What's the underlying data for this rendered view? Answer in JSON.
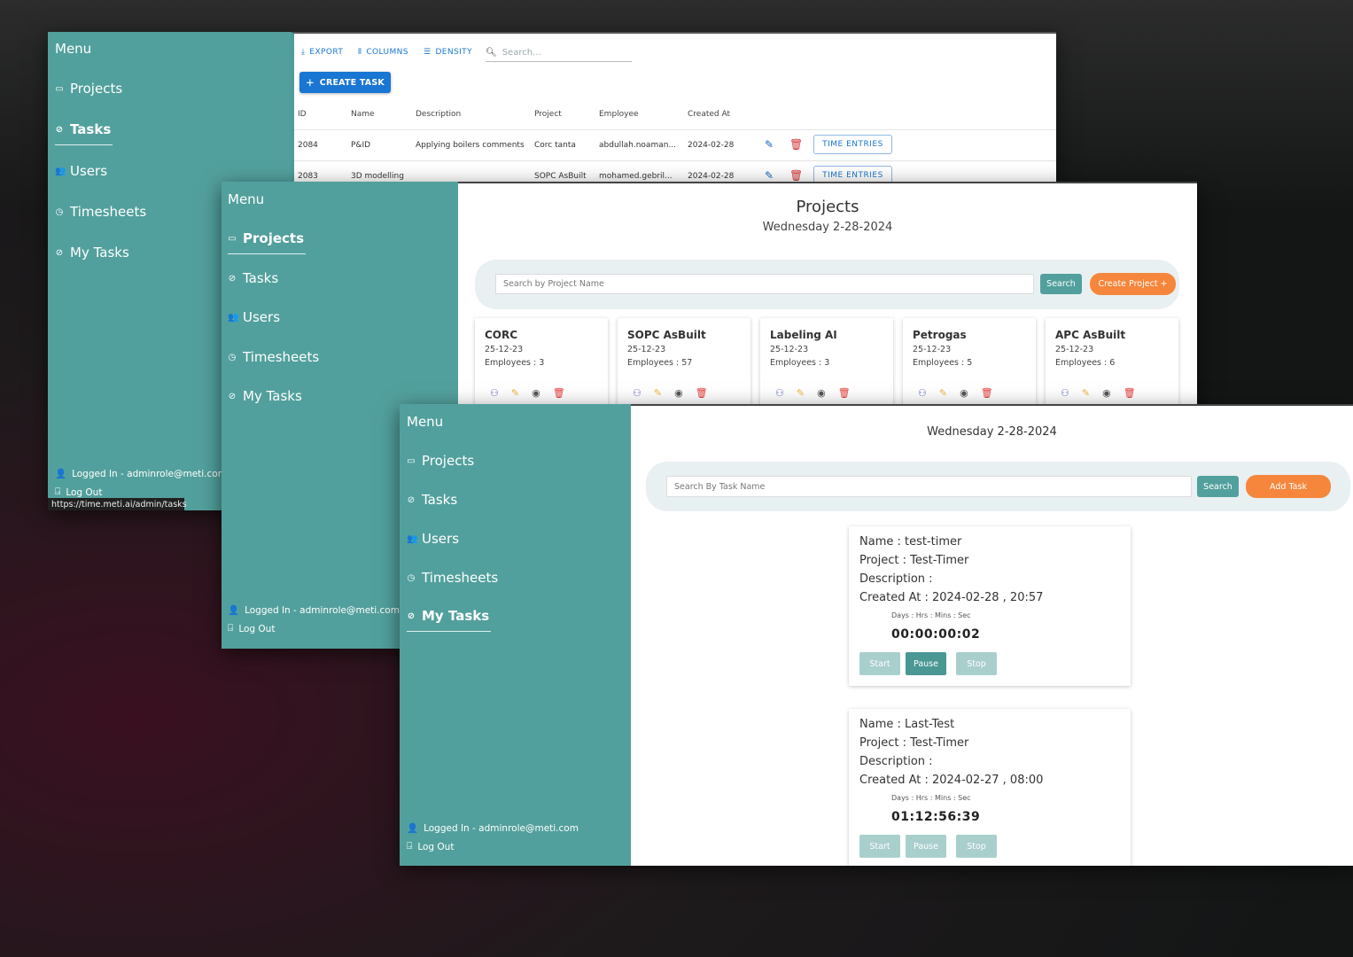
{
  "sidebar_common": {
    "menu_title": "Menu",
    "items": [
      {
        "label": "Projects",
        "icon": "folder-icon"
      },
      {
        "label": "Tasks",
        "icon": "check-circle-icon"
      },
      {
        "label": "Users",
        "icon": "users-icon"
      },
      {
        "label": "Timesheets",
        "icon": "clock-icon"
      },
      {
        "label": "My Tasks",
        "icon": "check-circle-icon"
      }
    ],
    "logged_in": "Logged In - adminrole@meti.com",
    "logout": "Log Out"
  },
  "window_tasks_admin": {
    "active_item": "Tasks",
    "status_url": "https://time.meti.ai/admin/tasks",
    "toolbar": {
      "export": "EXPORT",
      "columns": "COLUMNS",
      "density": "DENSITY",
      "search_placeholder": "Search…"
    },
    "create_button": "CREATE TASK",
    "columns": [
      "ID",
      "Name",
      "Description",
      "Project",
      "Employee",
      "Created At"
    ],
    "rows": [
      {
        "id": "2084",
        "name": "P&ID",
        "description": "Applying boilers comments",
        "project": "Corc tanta",
        "employee": "abdullah.noaman...",
        "created_at": "2024-02-28",
        "action": "TIME ENTRIES"
      },
      {
        "id": "2083",
        "name": "3D modelling",
        "description": "",
        "project": "SOPC AsBuilt",
        "employee": "mohamed.gebril...",
        "created_at": "2024-02-28",
        "action": "TIME ENTRIES"
      }
    ]
  },
  "window_projects": {
    "active_item": "Projects",
    "title": "Projects",
    "date": "Wednesday 2-28-2024",
    "search_placeholder": "Search by Project Name",
    "search_button": "Search",
    "create_button": "Create Project +",
    "projects": [
      {
        "name": "CORC",
        "date": "25-12-23",
        "employees": "Employees : 3"
      },
      {
        "name": "SOPC AsBuilt",
        "date": "25-12-23",
        "employees": "Employees : 57"
      },
      {
        "name": "Labeling AI",
        "date": "25-12-23",
        "employees": "Employees : 3"
      },
      {
        "name": "Petrogas",
        "date": "25-12-23",
        "employees": "Employees : 5"
      },
      {
        "name": "APC AsBuilt",
        "date": "25-12-23",
        "employees": "Employees : 6"
      }
    ],
    "card_icons": [
      "add-user-icon",
      "edit-pencil-icon",
      "eye-icon",
      "trash-icon"
    ],
    "colors": {
      "add_user": "#6a72c8",
      "edit": "#f0b43a",
      "view": "#555555",
      "delete": "#e53935"
    }
  },
  "window_my_tasks": {
    "active_item": "My Tasks",
    "date": "Wednesday 2-28-2024",
    "search_placeholder": "Search By Task Name",
    "search_button": "Search",
    "add_button": "Add Task",
    "timer_units": "Days : Hrs : Mins : Sec",
    "tasks": [
      {
        "name": "Name : test-timer",
        "project": "Project : Test-Timer",
        "description": "Description :",
        "created_at": "Created At : 2024-02-28 , 20:57",
        "timer": "00:00:00:02",
        "active_button": "Pause"
      },
      {
        "name": "Name : Last-Test",
        "project": "Project : Test-Timer",
        "description": "Description :",
        "created_at": "Created At : 2024-02-27 , 08:00",
        "timer": "01:12:56:39",
        "active_button": "none"
      }
    ],
    "buttons": {
      "start": "Start",
      "pause": "Pause",
      "stop": "Stop"
    }
  },
  "colors": {
    "sidebar_teal": "#52a09d",
    "accent_orange": "#f5863b",
    "grid_blue": "#1976d2"
  }
}
